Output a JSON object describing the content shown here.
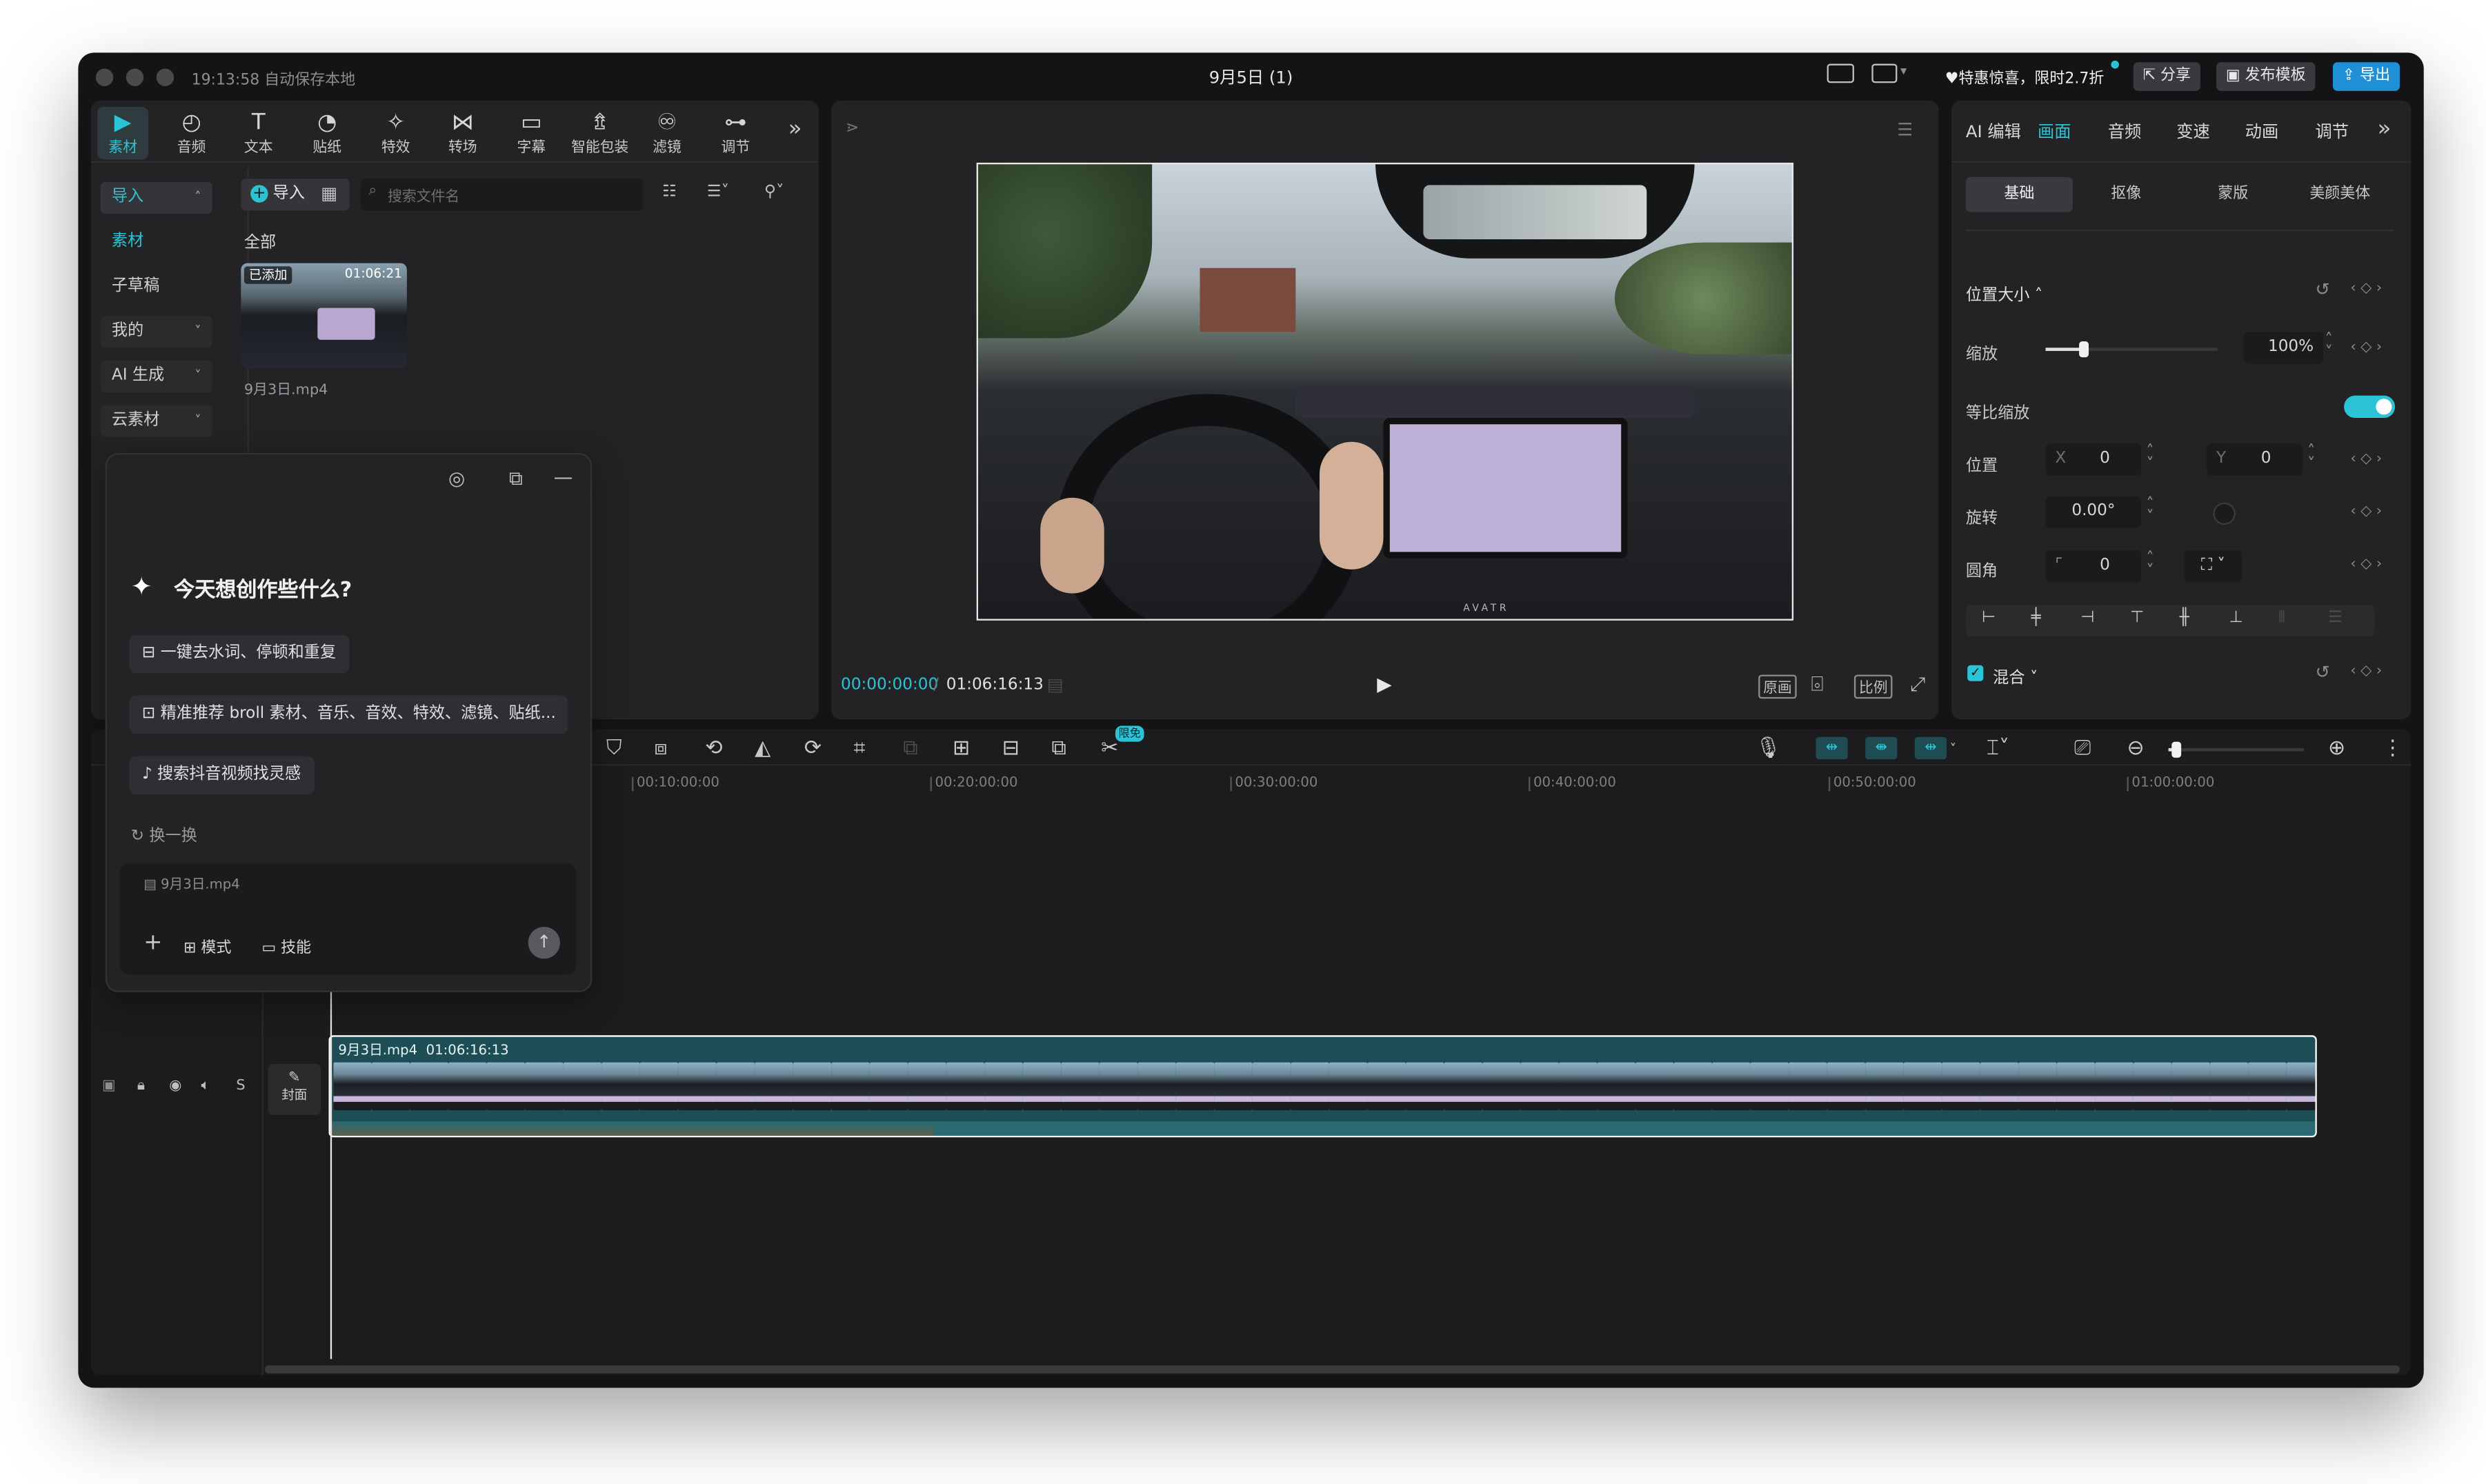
{
  "titlebar": {
    "autosave": "19:13:58 自动保存本地",
    "project_title": "9月5日 (1)",
    "promo": "特惠惊喜，限时2.7折",
    "share": "分享",
    "publish_template": "发布模板",
    "export": "导出"
  },
  "toolbar": {
    "items": [
      {
        "label": "素材",
        "icon": "media-icon"
      },
      {
        "label": "音频",
        "icon": "audio-icon"
      },
      {
        "label": "文本",
        "icon": "text-icon"
      },
      {
        "label": "贴纸",
        "icon": "sticker-icon"
      },
      {
        "label": "特效",
        "icon": "effects-icon"
      },
      {
        "label": "转场",
        "icon": "transition-icon"
      },
      {
        "label": "字幕",
        "icon": "subtitle-icon"
      },
      {
        "label": "智能包装",
        "icon": "smart-pack-icon"
      },
      {
        "label": "滤镜",
        "icon": "filter-icon"
      },
      {
        "label": "调节",
        "icon": "adjust-icon"
      }
    ]
  },
  "sidebar": {
    "items": [
      {
        "label": "导入"
      },
      {
        "label": "素材"
      },
      {
        "label": "子草稿"
      },
      {
        "label": "我的"
      },
      {
        "label": "AI 生成"
      },
      {
        "label": "云素材"
      }
    ]
  },
  "media": {
    "import_button": "导入",
    "search_placeholder": "搜索文件名",
    "filter_all": "全部",
    "clip": {
      "badge": "已添加",
      "duration": "01:06:21",
      "filename": "9月3日.mp4"
    }
  },
  "ai_panel": {
    "heading": "今天想创作些什么?",
    "suggestions": [
      "一键去水词、停顿和重复",
      "精准推荐 broll 素材、音乐、音效、特效、滤镜、贴纸...",
      "搜索抖音视频找灵感"
    ],
    "refresh": "换一换",
    "attachment": "9月3日.mp4",
    "mode_button": "模式",
    "skills_button": "技能"
  },
  "player": {
    "current_time": "00:00:00:00",
    "total_time": "01:06:16:13",
    "original_button": "原画",
    "ratio_button": "比例",
    "dash_badge": "AVATR"
  },
  "inspector": {
    "tabs": [
      "AI 编辑",
      "画面",
      "音频",
      "变速",
      "动画",
      "调节"
    ],
    "active_tab": "画面",
    "subtabs": [
      "基础",
      "抠像",
      "蒙版",
      "美颜美体"
    ],
    "active_subtab": "基础",
    "section_title": "位置大小",
    "scale_label": "缩放",
    "scale_value": "100%",
    "scale_fraction": 0.22,
    "uniform_scale_label": "等比缩放",
    "uniform_scale_on": true,
    "position_label": "位置",
    "x_label": "X",
    "x_value": "0",
    "y_label": "Y",
    "y_value": "0",
    "rotation_label": "旋转",
    "rotation_value": "0.00°",
    "corner_label": "圆角",
    "corner_value": "0",
    "blend_label": "混合",
    "blend_checked": true
  },
  "timeline": {
    "ruler": [
      "00:10:00:00",
      "00:20:00:00",
      "00:30:00:00",
      "00:40:00:00",
      "00:50:00:00",
      "01:00:00:00"
    ],
    "limited_badge": "限免",
    "cover_label": "封面",
    "track_s": "S",
    "clip": {
      "name": "9月3日.mp4",
      "duration": "01:06:16:13"
    },
    "zoom_fraction": 0.06
  },
  "colors": {
    "accent": "#2ac4d6",
    "export_bg": "#1f8fd6",
    "window_bg": "#141416",
    "panel_bg": "#232326",
    "clip_border": "#ffffff",
    "clip_fill": "#1d4e55"
  }
}
